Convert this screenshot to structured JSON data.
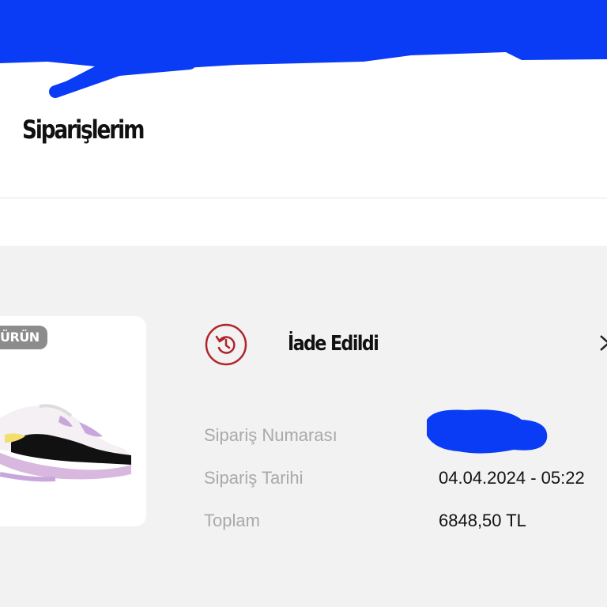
{
  "header": {
    "title": "Siparişlerim",
    "redaction_color": "#0a3cf5"
  },
  "order": {
    "badge": "ÜRÜN",
    "status": "İade Edildi",
    "status_color": "#b0252b",
    "status_icon": "return-icon",
    "rows": [
      {
        "label": "Sipariş Numarası",
        "value": ""
      },
      {
        "label": "Sipariş Tarihi",
        "value": "04.04.2024 - 05:22"
      },
      {
        "label": "Toplam",
        "value": "6848,50 TL"
      }
    ]
  }
}
